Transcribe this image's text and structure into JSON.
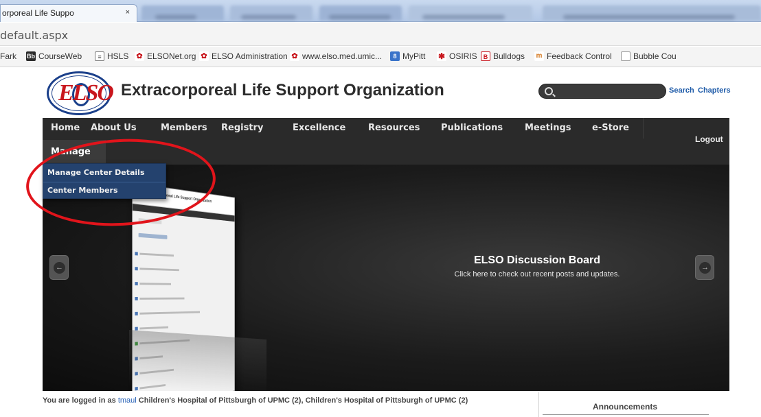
{
  "browser": {
    "active_tab_title": "orporeal Life Suppo",
    "active_tab_close": "×",
    "url": "default.aspx"
  },
  "bookmarks": [
    {
      "label": "Fark",
      "icon": ""
    },
    {
      "label": "CourseWeb",
      "icon": "courseweb-icon"
    },
    {
      "label": "HSLS",
      "icon": "hsls-icon"
    },
    {
      "label": "ELSONet.org",
      "icon": "elso-icon"
    },
    {
      "label": "ELSO Administration",
      "icon": "elso-icon"
    },
    {
      "label": "www.elso.med.umic...",
      "icon": "elso-icon"
    },
    {
      "label": "MyPitt",
      "icon": "mypitt-icon"
    },
    {
      "label": "OSIRIS",
      "icon": "osiris-icon"
    },
    {
      "label": "Bulldogs",
      "icon": "bulldogs-icon"
    },
    {
      "label": "Feedback Control",
      "icon": "feedback-icon"
    },
    {
      "label": "Bubble Cou",
      "icon": "page-icon"
    }
  ],
  "site": {
    "logo_text": "ELSO",
    "title": "Extracorporeal Life Support Organization",
    "search_label": "Search",
    "chapters_label": "Chapters"
  },
  "nav": {
    "items": [
      "Home",
      "About Us",
      "Members",
      "Registry",
      "Excellence",
      "Resources",
      "Publications",
      "Meetings",
      "e-Store"
    ],
    "manage": "Manage",
    "logout": "Logout"
  },
  "dropdown": {
    "items": [
      "Manage Center Details",
      "Center Members"
    ]
  },
  "slider": {
    "title": "ELSO Discussion Board",
    "subtitle": "Click here to check out recent posts and updates.",
    "thumbnail_title": "Extracorporeal Life Support Organization"
  },
  "footer": {
    "login_prefix": "You are logged in as",
    "username": "tmaul",
    "login_suffix": "Children's Hospital of Pittsburgh of UPMC (2), Children's Hospital of Pittsburgh of UPMC (2)",
    "announcements": "Announcements"
  },
  "colors": {
    "nav_bg": "#2a2a2a",
    "dropdown_bg": "#24426e",
    "annotation": "#e1141b",
    "link": "#2b64b8"
  }
}
